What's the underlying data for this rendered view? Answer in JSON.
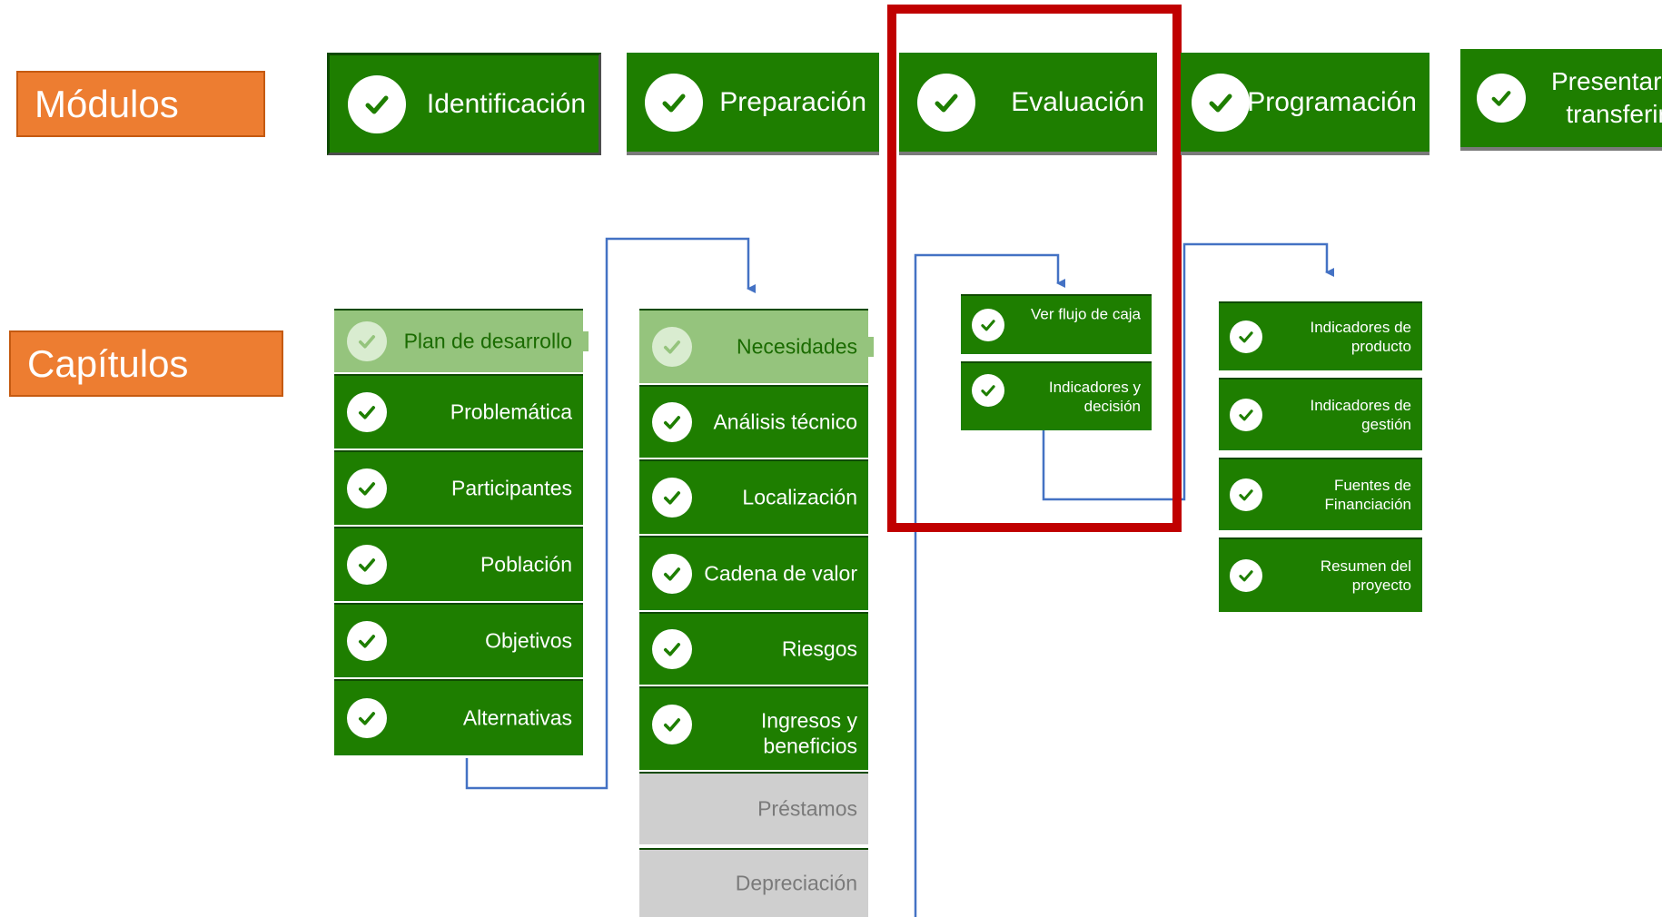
{
  "labels": {
    "modules": "Módulos",
    "chapters": "Capítulos"
  },
  "modules": [
    {
      "name": "Identificación"
    },
    {
      "name": "Preparación"
    },
    {
      "name": "Evaluación"
    },
    {
      "name": "Programación"
    },
    {
      "name_line1": "Presentar y",
      "name_line2": "transferir"
    }
  ],
  "identificacion_chapters": [
    {
      "label": "Plan de desarrollo",
      "state": "completed-light"
    },
    {
      "label": "Problemática",
      "state": "completed"
    },
    {
      "label": "Participantes",
      "state": "completed"
    },
    {
      "label": "Población",
      "state": "completed"
    },
    {
      "label": "Objetivos",
      "state": "completed"
    },
    {
      "label": "Alternativas",
      "state": "completed"
    }
  ],
  "preparacion_chapters": [
    {
      "label": "Necesidades",
      "state": "completed-light"
    },
    {
      "label": "Análisis técnico",
      "state": "completed"
    },
    {
      "label": "Localización",
      "state": "completed"
    },
    {
      "label": "Cadena de valor",
      "state": "completed"
    },
    {
      "label": "Riesgos",
      "state": "completed"
    },
    {
      "label_line1": "Ingresos y",
      "label_line2": "beneficios",
      "state": "completed"
    },
    {
      "label": "Préstamos",
      "state": "disabled"
    },
    {
      "label": "Depreciación",
      "state": "disabled"
    }
  ],
  "evaluacion_chapters": [
    {
      "label": "Ver flujo de caja",
      "state": "completed"
    },
    {
      "label_line1": "Indicadores y",
      "label_line2": "decisión",
      "state": "completed"
    }
  ],
  "programacion_chapters": [
    {
      "label_line1": "Indicadores de",
      "label_line2": "producto",
      "state": "completed"
    },
    {
      "label_line1": "Indicadores de",
      "label_line2": "gestión",
      "state": "completed"
    },
    {
      "label_line1": "Fuentes de",
      "label_line2": "Financiación",
      "state": "completed"
    },
    {
      "label_line1": "Resumen del",
      "label_line2": "proyecto",
      "state": "completed"
    }
  ],
  "colors": {
    "module_green": "#1e7e00",
    "light_green": "#95c47d",
    "disabled_grey": "#cfcfcf",
    "label_orange": "#ed7d31",
    "highlight_red": "#c00000",
    "connector_blue": "#4472c4"
  },
  "icons": {
    "status": "check-circle-icon"
  }
}
